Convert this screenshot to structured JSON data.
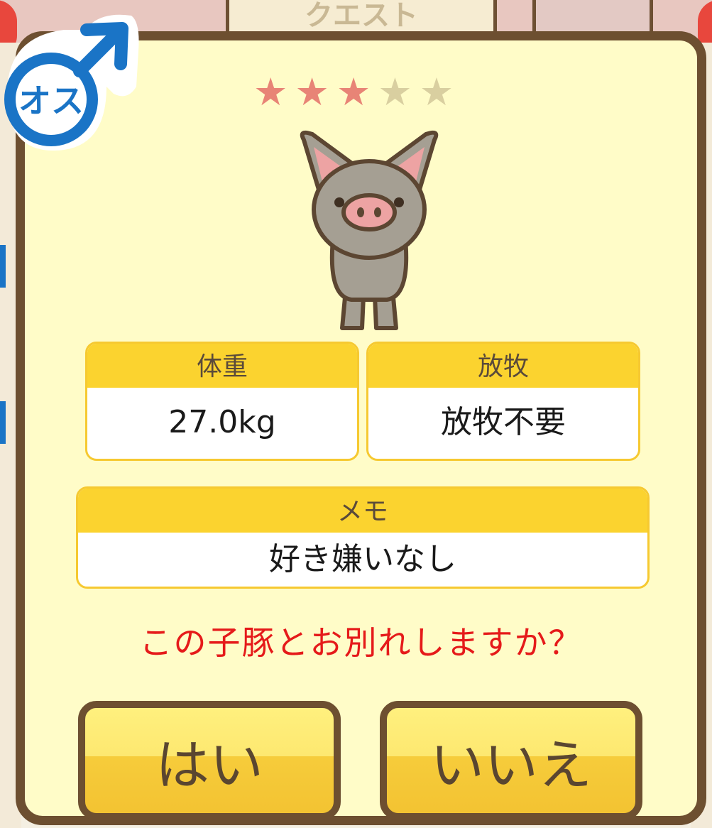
{
  "background": {
    "quest_label": "クエスト"
  },
  "dialog": {
    "gender_badge": {
      "label": "オス",
      "icon": "male-symbol-icon"
    },
    "rating": {
      "value": 3,
      "max": 5
    },
    "weight": {
      "label": "体重",
      "value": "27.0kg"
    },
    "grazing": {
      "label": "放牧",
      "value": "放牧不要"
    },
    "memo": {
      "label": "メモ",
      "value": "好き嫌いなし"
    },
    "question": "この子豚とお別れしますか？",
    "yes_label": "はい",
    "no_label": "いいえ"
  },
  "colors": {
    "frame": "#6d4f30",
    "panel": "#fffcc8",
    "header_yellow": "#fbd32f",
    "question_red": "#e51a1a",
    "gender_blue": "#1a74c6"
  }
}
